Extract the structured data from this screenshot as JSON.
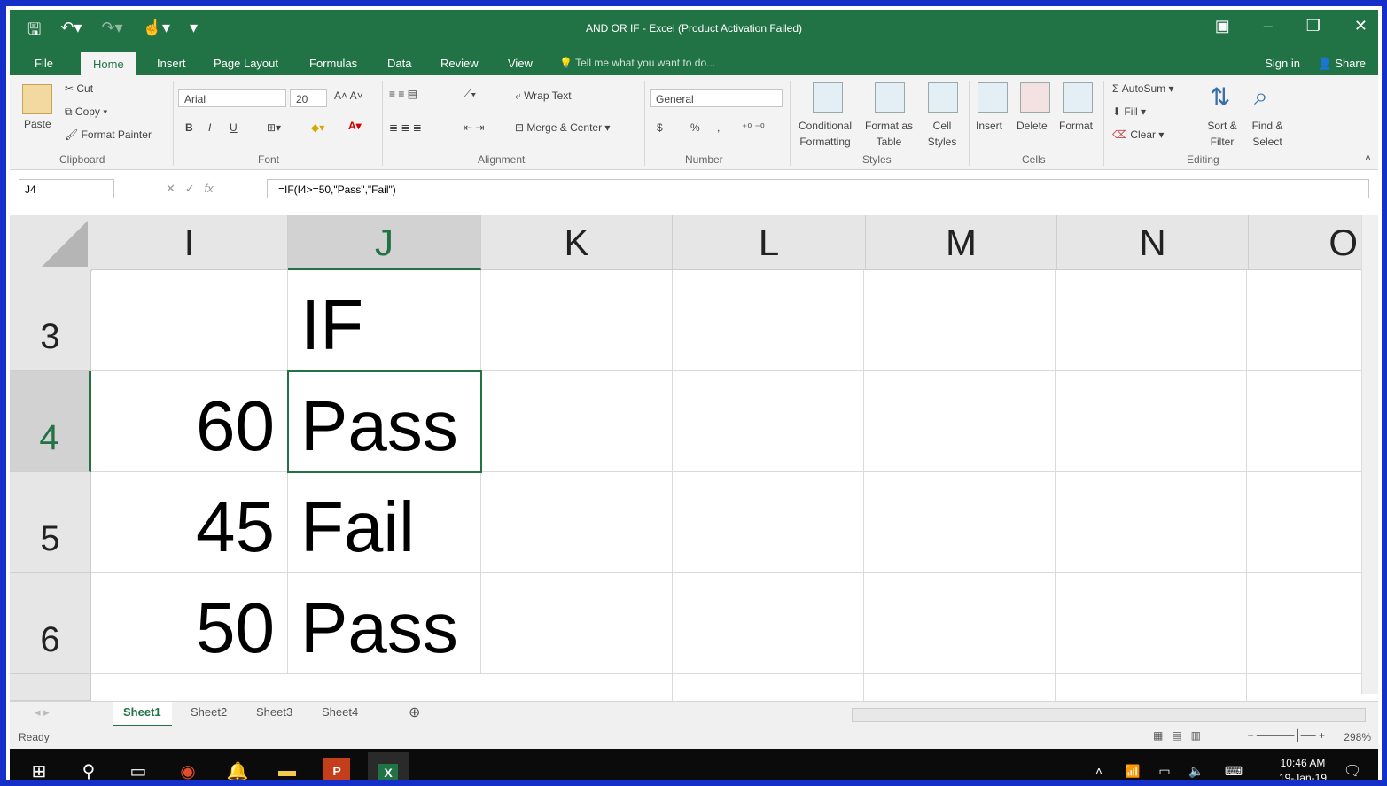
{
  "window": {
    "title": "AND OR IF - Excel (Product Activation Failed)",
    "controls": [
      "▣",
      "–",
      "❐",
      "✕"
    ]
  },
  "ribbon_tabs": [
    "File",
    "Home",
    "Insert",
    "Page Layout",
    "Formulas",
    "Data",
    "Review",
    "View"
  ],
  "active_tab": "Home",
  "tell_me": "Tell me what you want to do...",
  "account": {
    "sign_in": "Sign in",
    "share": "Share"
  },
  "clipboard": {
    "paste": "Paste",
    "cut": "Cut",
    "copy": "Copy",
    "format_painter": "Format Painter",
    "label": "Clipboard"
  },
  "font": {
    "name": "Arial",
    "size": "20",
    "label": "Font",
    "bold": "B",
    "italic": "I",
    "underline": "U"
  },
  "alignment": {
    "wrap_text": "Wrap Text",
    "merge_center": "Merge & Center",
    "label": "Alignment"
  },
  "number": {
    "format": "General",
    "label": "Number",
    "currency": "$",
    "percent": "%",
    "comma": ","
  },
  "styles": {
    "conditional": "Conditional Formatting",
    "format_table": "Format as Table",
    "cell_styles": "Cell Styles",
    "label": "Styles"
  },
  "cells": {
    "insert": "Insert",
    "delete": "Delete",
    "format": "Format",
    "label": "Cells"
  },
  "editing": {
    "autosum": "AutoSum",
    "fill": "Fill",
    "clear": "Clear",
    "sort_filter": "Sort & Filter",
    "find_select": "Find & Select",
    "label": "Editing"
  },
  "formula_bar": {
    "name_box": "J4",
    "fx": "fx",
    "formula": "=IF(I4>=50,\"Pass\",\"Fail\")"
  },
  "columns": [
    "I",
    "J",
    "K",
    "L",
    "M",
    "N",
    "O"
  ],
  "selected_column": "J",
  "rows": [
    {
      "num": "3",
      "I": "",
      "J": "IF"
    },
    {
      "num": "4",
      "I": "60",
      "J": "Pass"
    },
    {
      "num": "5",
      "I": "45",
      "J": "Fail"
    },
    {
      "num": "6",
      "I": "50",
      "J": "Pass"
    }
  ],
  "active_cell": "J4",
  "sheets": [
    "Sheet1",
    "Sheet2",
    "Sheet3",
    "Sheet4"
  ],
  "active_sheet": "Sheet1",
  "status": {
    "state": "Ready",
    "zoom": "298%"
  },
  "taskbar": {
    "time": "10:46 AM",
    "date": "19-Jan-19"
  },
  "colors": {
    "excel_green": "#217346",
    "ribbon_bg": "#f3f3f3",
    "frame_blue": "#1430c8"
  }
}
